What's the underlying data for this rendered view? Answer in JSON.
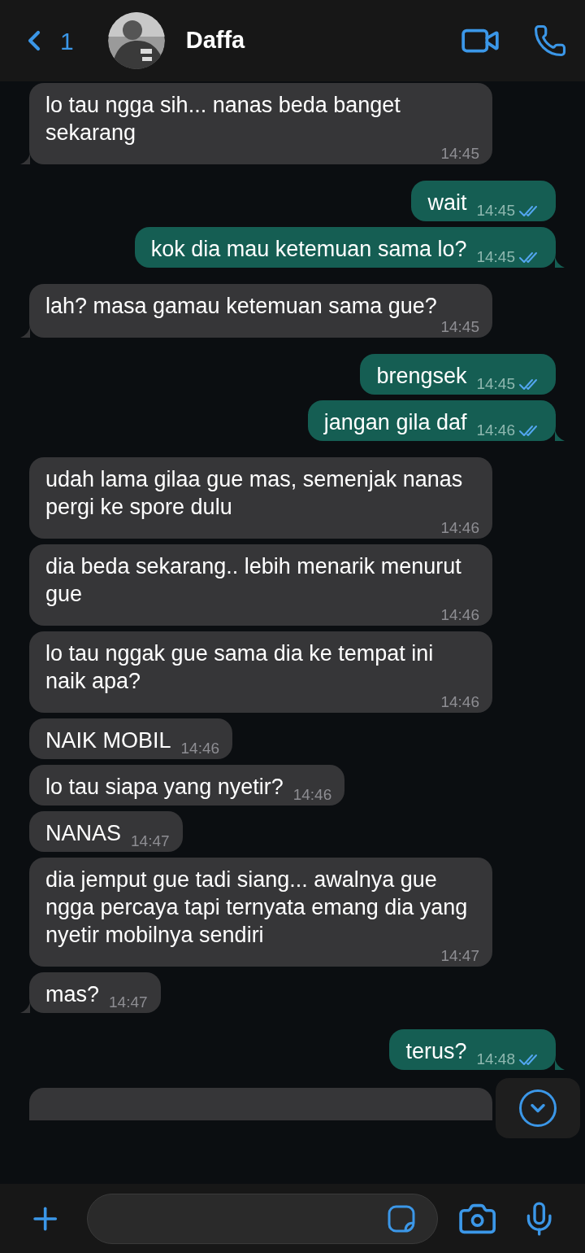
{
  "header": {
    "back_count": "1",
    "contact_name": "Daffa"
  },
  "messages": [
    {
      "kind": "incoming",
      "text": "lo tau ngga sih... nanas beda banget sekarang",
      "time": "14:45",
      "tail": true
    },
    {
      "kind": "outgoing",
      "text": "wait",
      "time": "14:45",
      "read": true,
      "tail": false
    },
    {
      "kind": "outgoing",
      "text": "kok dia mau ketemuan sama lo?",
      "time": "14:45",
      "read": true,
      "tail": true
    },
    {
      "kind": "incoming",
      "text": "lah? masa gamau ketemuan sama gue?",
      "time": "14:45",
      "tail": true
    },
    {
      "kind": "outgoing",
      "text": "brengsek",
      "time": "14:45",
      "read": true,
      "tail": false
    },
    {
      "kind": "outgoing",
      "text": "jangan gila daf",
      "time": "14:46",
      "read": true,
      "tail": true
    },
    {
      "kind": "incoming",
      "text": "udah lama gilaa gue mas, semenjak nanas pergi ke spore dulu",
      "time": "14:46",
      "tail": false
    },
    {
      "kind": "incoming",
      "text": "dia beda sekarang.. lebih menarik menurut gue",
      "time": "14:46",
      "tail": false
    },
    {
      "kind": "incoming",
      "text": "lo tau nggak gue sama dia ke tempat ini naik apa?",
      "time": "14:46",
      "tail": false
    },
    {
      "kind": "incoming",
      "text": "NAIK MOBIL",
      "time": "14:46",
      "tail": false
    },
    {
      "kind": "incoming",
      "text": "lo tau siapa yang nyetir?",
      "time": "14:46",
      "tail": false
    },
    {
      "kind": "incoming",
      "text": "NANAS",
      "time": "14:47",
      "tail": false
    },
    {
      "kind": "incoming",
      "text": "dia jemput gue tadi siang... awalnya gue ngga percaya tapi ternyata emang dia yang nyetir mobilnya sendiri",
      "time": "14:47",
      "tail": false
    },
    {
      "kind": "incoming",
      "text": "mas?",
      "time": "14:47",
      "tail": true
    },
    {
      "kind": "outgoing",
      "text": "terus?",
      "time": "14:48",
      "read": true,
      "tail": true
    }
  ]
}
